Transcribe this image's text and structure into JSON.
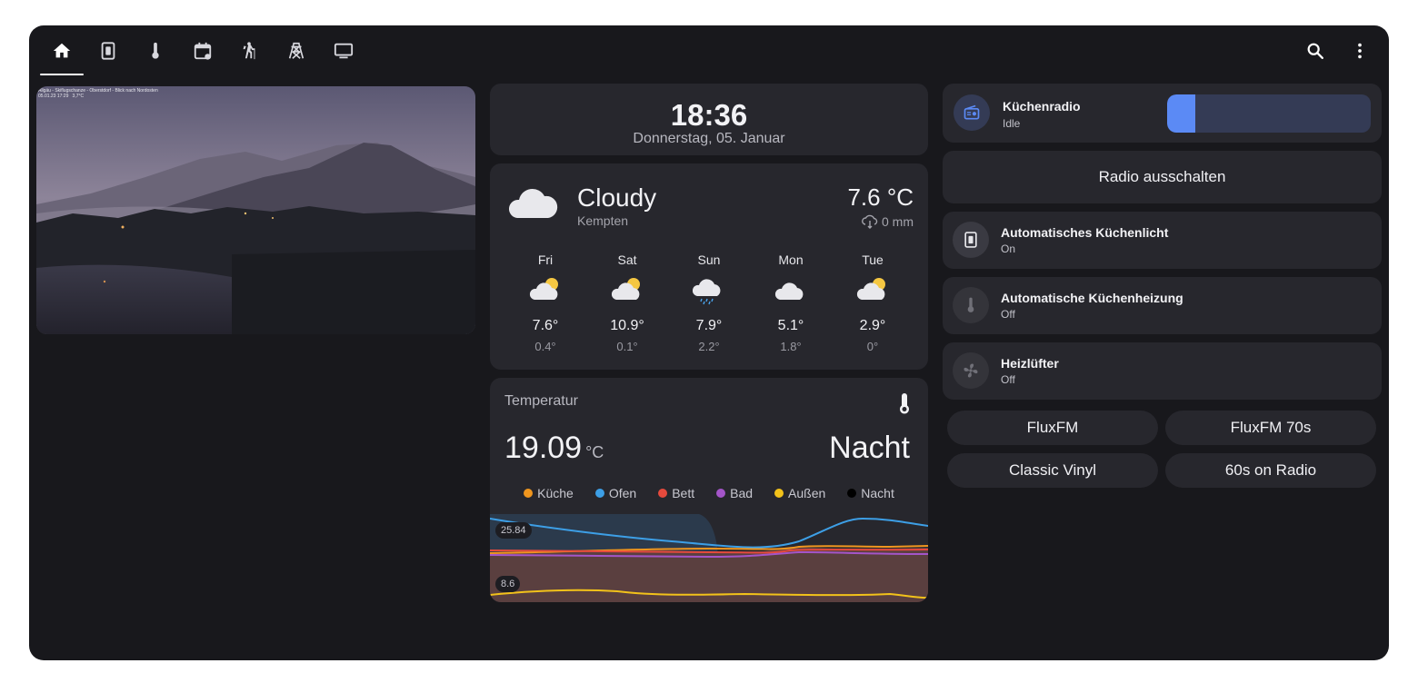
{
  "tabs": [
    {
      "id": "home",
      "icon": "home-icon",
      "active": true
    },
    {
      "id": "switch",
      "icon": "light-switch-icon"
    },
    {
      "id": "thermometer",
      "icon": "thermometer-icon"
    },
    {
      "id": "calendar",
      "icon": "calendar-icon"
    },
    {
      "id": "hiking",
      "icon": "hiking-icon"
    },
    {
      "id": "tower",
      "icon": "transmission-tower-icon"
    },
    {
      "id": "monitor",
      "icon": "monitor-icon"
    }
  ],
  "actions": {
    "search": "search-icon",
    "menu": "more-vert-icon"
  },
  "camera": {
    "overlay": "Allgäu - Skiflugschanze - Oberstdorf - Blick nach Nordosten\n05.01.23 17:29   3,7°C"
  },
  "clock": {
    "time": "18:36",
    "date": "Donnerstag, 05. Januar"
  },
  "weather": {
    "condition": "Cloudy",
    "location": "Kempten",
    "temperature": "7.6 °C",
    "precipitation": "0 mm",
    "forecast": [
      {
        "day": "Fri",
        "icon": "partly-cloudy-icon",
        "high": "7.6°",
        "low": "0.4°"
      },
      {
        "day": "Sat",
        "icon": "partly-cloudy-icon",
        "high": "10.9°",
        "low": "0.1°"
      },
      {
        "day": "Sun",
        "icon": "rainy-icon",
        "high": "7.9°",
        "low": "2.2°"
      },
      {
        "day": "Mon",
        "icon": "cloudy-icon",
        "high": "5.1°",
        "low": "1.8°"
      },
      {
        "day": "Tue",
        "icon": "partly-cloudy-icon",
        "high": "2.9°",
        "low": "0°"
      }
    ]
  },
  "temperature_card": {
    "name": "Temperatur",
    "value": "19.09",
    "unit": "°C",
    "state": "Nacht",
    "legend": [
      {
        "name": "Küche",
        "color": "#f0961e"
      },
      {
        "name": "Ofen",
        "color": "#3d9fe6"
      },
      {
        "name": "Bett",
        "color": "#e64a3d"
      },
      {
        "name": "Bad",
        "color": "#a455c9"
      },
      {
        "name": "Außen",
        "color": "#f2c21a"
      },
      {
        "name": "Nacht",
        "color": "#000000"
      }
    ],
    "y_max_label": "25.84",
    "y_min_label": "8.6"
  },
  "radio": {
    "name": "Küchenradio",
    "state": "Idle",
    "volume_fraction": 0.14,
    "icon": "radio-icon",
    "accent": "#5b8af5"
  },
  "radio_off_button": "Radio ausschalten",
  "entities": [
    {
      "name": "Automatisches Küchenlicht",
      "state": "On",
      "icon": "light-switch-icon"
    },
    {
      "name": "Automatische Küchenheizung",
      "state": "Off",
      "icon": "thermometer-icon"
    },
    {
      "name": "Heizlüfter",
      "state": "Off",
      "icon": "fan-icon"
    }
  ],
  "stations": [
    "FluxFM",
    "FluxFM 70s",
    "Classic Vinyl",
    "60s on Radio"
  ]
}
